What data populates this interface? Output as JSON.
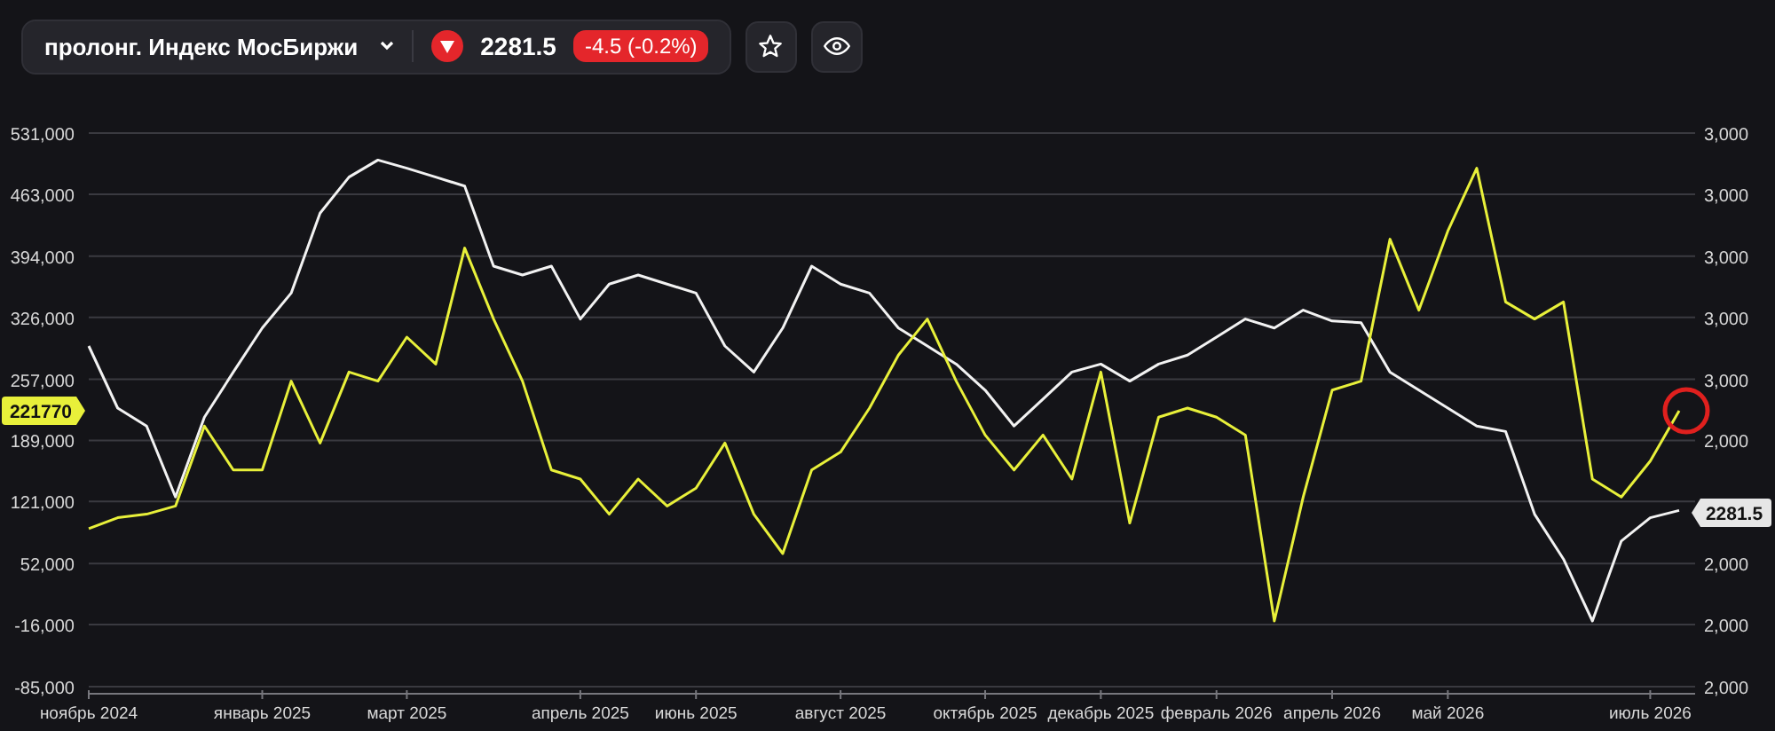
{
  "toolbar": {
    "instrument": "пролонг. Индекс МосБиржи",
    "falling": true,
    "price": "2281.5",
    "change": "-4.5 (-0.2%)"
  },
  "chart": {
    "chart_data": {
      "type": "line",
      "grid": true,
      "ylim": [
        -85000,
        531000
      ],
      "categories": [
        "ноябрь 2024",
        null,
        null,
        null,
        null,
        null,
        "январь 2025",
        null,
        null,
        null,
        null,
        "март 2025",
        null,
        null,
        null,
        null,
        null,
        "апрель 2025",
        null,
        null,
        null,
        "июнь 2025",
        null,
        null,
        null,
        null,
        "август 2025",
        null,
        null,
        null,
        null,
        "октябрь 2025",
        null,
        null,
        null,
        "декабрь 2025",
        null,
        null,
        null,
        "февраль 2026",
        null,
        null,
        null,
        "апрель 2026",
        null,
        null,
        null,
        "май 2026",
        null,
        null,
        null,
        null,
        null,
        null,
        "июль 2026",
        null
      ],
      "yticks": [
        {
          "value": 531000,
          "label": "531,000"
        },
        {
          "value": 463000,
          "label": "463,000"
        },
        {
          "value": 394000,
          "label": "394,000"
        },
        {
          "value": 326000,
          "label": "326,000"
        },
        {
          "value": 257000,
          "label": "257,000"
        },
        {
          "value": 189000,
          "label": "189,000"
        },
        {
          "value": 121000,
          "label": "121,000"
        },
        {
          "value": 52000,
          "label": "52,000"
        },
        {
          "value": -16000,
          "label": "-16,000"
        },
        {
          "value": -85000,
          "label": "-85,000"
        }
      ],
      "series": [
        {
          "color": "#e8f03a",
          "values": [
            91000,
            103000,
            107000,
            116000,
            205000,
            156000,
            156000,
            255000,
            186000,
            265000,
            255000,
            304000,
            274000,
            403000,
            324000,
            255000,
            156000,
            146000,
            107000,
            146000,
            116000,
            136000,
            186000,
            107000,
            63000,
            156000,
            176000,
            225000,
            284000,
            324000,
            255000,
            195000,
            156000,
            195000,
            146000,
            265000,
            97000,
            215000,
            225000,
            215000,
            195000,
            -12000,
            126000,
            245000,
            255000,
            413000,
            334000,
            422000,
            492000,
            343000,
            324000,
            343000,
            146000,
            126000,
            166000,
            222000
          ]
        },
        {
          "color": "#f2f2f2",
          "values": [
            294000,
            225000,
            205000,
            126000,
            215000,
            265000,
            314000,
            353000,
            442000,
            482000,
            501000,
            492000,
            482000,
            472000,
            383000,
            373000,
            383000,
            324000,
            363000,
            373000,
            363000,
            353000,
            294000,
            265000,
            314000,
            383000,
            363000,
            353000,
            314000,
            294000,
            274000,
            245000,
            205000,
            235000,
            265000,
            274000,
            255000,
            274000,
            284000,
            304000,
            324000,
            314000,
            334000,
            322000,
            320000,
            265000,
            245000,
            225000,
            205000,
            199000,
            107000,
            57000,
            -12000,
            77000,
            103000,
            111000
          ]
        }
      ]
    },
    "right_axis_labels": [
      "3,000",
      "3,000",
      "3,000",
      "3,000",
      "3,000",
      "2,000",
      "2,000",
      "2,000",
      "2,000"
    ],
    "last_value_tag": "221770",
    "price_tag": "2281.5",
    "highlight_circle": true
  }
}
